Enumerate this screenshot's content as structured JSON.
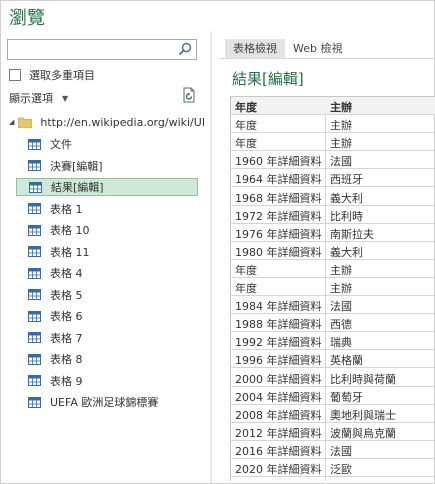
{
  "window": {
    "title": "瀏覽"
  },
  "search": {
    "placeholder": "",
    "value": ""
  },
  "multi_select": {
    "label": "選取多重項目"
  },
  "display_options": {
    "label": "顯示選項"
  },
  "tree": {
    "root": "http://en.wikipedia.org/wiki/UE...",
    "items": [
      {
        "label": "文件",
        "selected": false
      },
      {
        "label": "決賽[編輯]",
        "selected": false
      },
      {
        "label": "結果[編輯]",
        "selected": true
      },
      {
        "label": "表格 1",
        "selected": false
      },
      {
        "label": "表格 10",
        "selected": false
      },
      {
        "label": "表格 11",
        "selected": false
      },
      {
        "label": "表格 4",
        "selected": false
      },
      {
        "label": "表格 5",
        "selected": false
      },
      {
        "label": "表格 6",
        "selected": false
      },
      {
        "label": "表格 7",
        "selected": false
      },
      {
        "label": "表格 8",
        "selected": false
      },
      {
        "label": "表格 9",
        "selected": false
      },
      {
        "label": "UEFA 歐洲足球錦標賽",
        "selected": false
      }
    ]
  },
  "tabs": [
    {
      "label": "表格檢視",
      "active": true
    },
    {
      "label": "Web 檢視",
      "active": false
    }
  ],
  "preview": {
    "title": "結果[編輯]",
    "columns": [
      "年度",
      "主辦"
    ],
    "rows": [
      [
        "年度",
        "主辦"
      ],
      [
        "年度",
        "主辦"
      ],
      [
        "1960 年詳細資料",
        "法國"
      ],
      [
        "1964 年詳細資料",
        "西班牙"
      ],
      [
        "1968 年詳細資料",
        "義大利"
      ],
      [
        "1972 年詳細資料",
        "比利時"
      ],
      [
        "1976 年詳細資料",
        "南斯拉夫"
      ],
      [
        "1980 年詳細資料",
        "義大利"
      ],
      [
        "年度",
        "主辦"
      ],
      [
        "年度",
        "主辦"
      ],
      [
        "1984 年詳細資料",
        "法國"
      ],
      [
        "1988 年詳細資料",
        "西德"
      ],
      [
        "1992 年詳細資料",
        "瑞典"
      ],
      [
        "1996 年詳細資料",
        "英格蘭"
      ],
      [
        "2000 年詳細資料",
        "比利時與荷蘭"
      ],
      [
        "2004 年詳細資料",
        "葡萄牙"
      ],
      [
        "2008 年詳細資料",
        "奧地利與瑞士"
      ],
      [
        "2012 年詳細資料",
        "波蘭與烏克蘭"
      ],
      [
        "2016 年詳細資料",
        "法國"
      ],
      [
        "2020 年詳細資料",
        "泛歐"
      ]
    ]
  },
  "colors": {
    "accent": "#217346",
    "selected_bg": "#cfe8d7",
    "selected_border": "#88c49c"
  },
  "icons": [
    "search-icon",
    "refresh-icon",
    "folder-icon",
    "table-icon",
    "caret-down-icon",
    "expand-triangle-icon"
  ]
}
